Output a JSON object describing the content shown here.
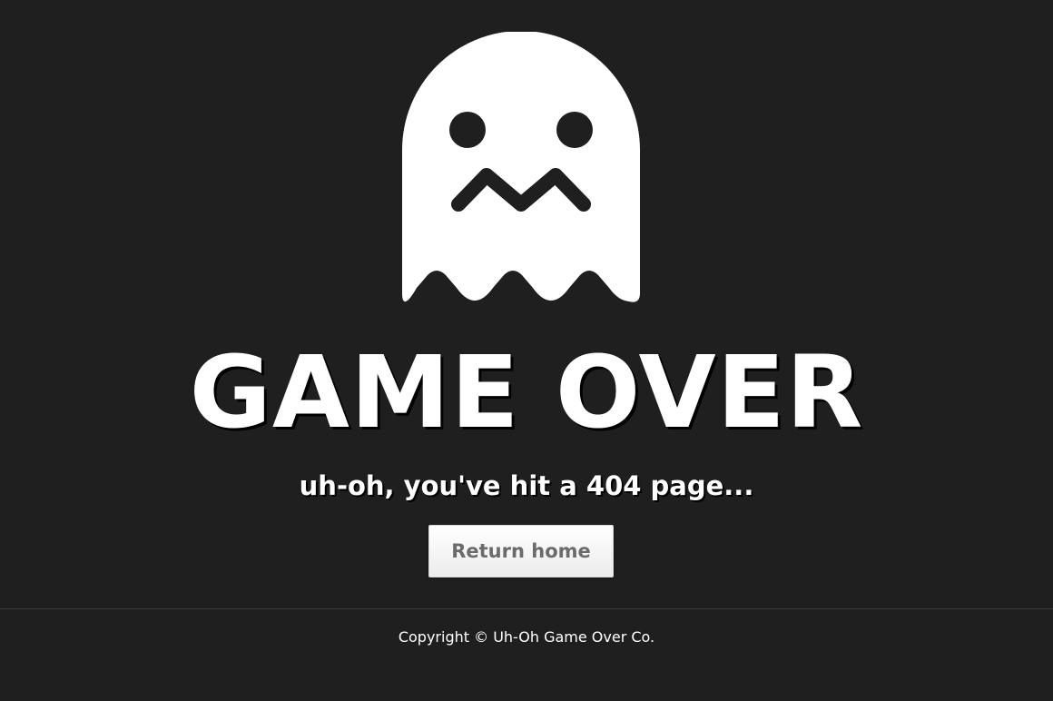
{
  "hero": {
    "icon": "ghost-icon",
    "title": "GAME OVER",
    "subtitle": "uh-oh, you've hit a 404 page..."
  },
  "actions": {
    "return_home_label": "Return home"
  },
  "footer": {
    "copyright": "Copyright © Uh-Oh Game Over Co."
  },
  "colors": {
    "background": "#1f1f1f",
    "ghost": "#ffffff",
    "text": "#ffffff",
    "button_text": "#6b6b6b"
  }
}
